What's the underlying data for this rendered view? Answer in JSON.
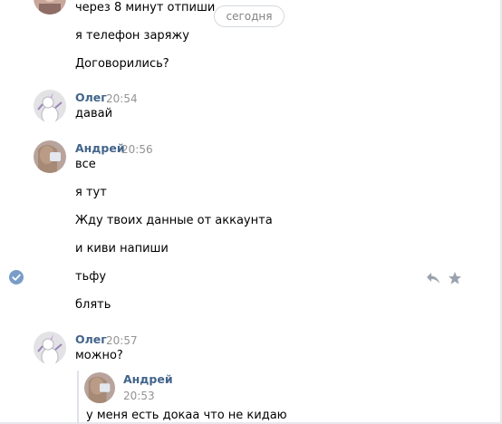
{
  "date_divider": "сегодня",
  "groups": [
    {
      "messages": [
        "через 8 минут отпиши",
        "я телефон заряжу",
        "Договорились?"
      ]
    },
    {
      "author": "Олег",
      "time": "20:54",
      "messages": [
        "давай"
      ]
    },
    {
      "author": "Андрей",
      "time": "20:56",
      "messages": [
        "все",
        "я тут",
        "Жду твоих данные от аккаунта",
        "и киви напиши",
        "тьфу",
        "блять"
      ]
    },
    {
      "author": "Олег",
      "time": "20:57",
      "messages": [
        "можно?"
      ]
    }
  ],
  "quote": {
    "author": "Андрей",
    "time": "20:53",
    "text": "у меня есть докаа что не кидаю"
  },
  "icons": {
    "selected": "check-circle-icon",
    "reply": "reply-icon",
    "favorite": "star-icon"
  },
  "colors": {
    "author": "#42648b",
    "time": "#939393",
    "icon": "#99a2ad",
    "check": "#7a9dc8"
  }
}
